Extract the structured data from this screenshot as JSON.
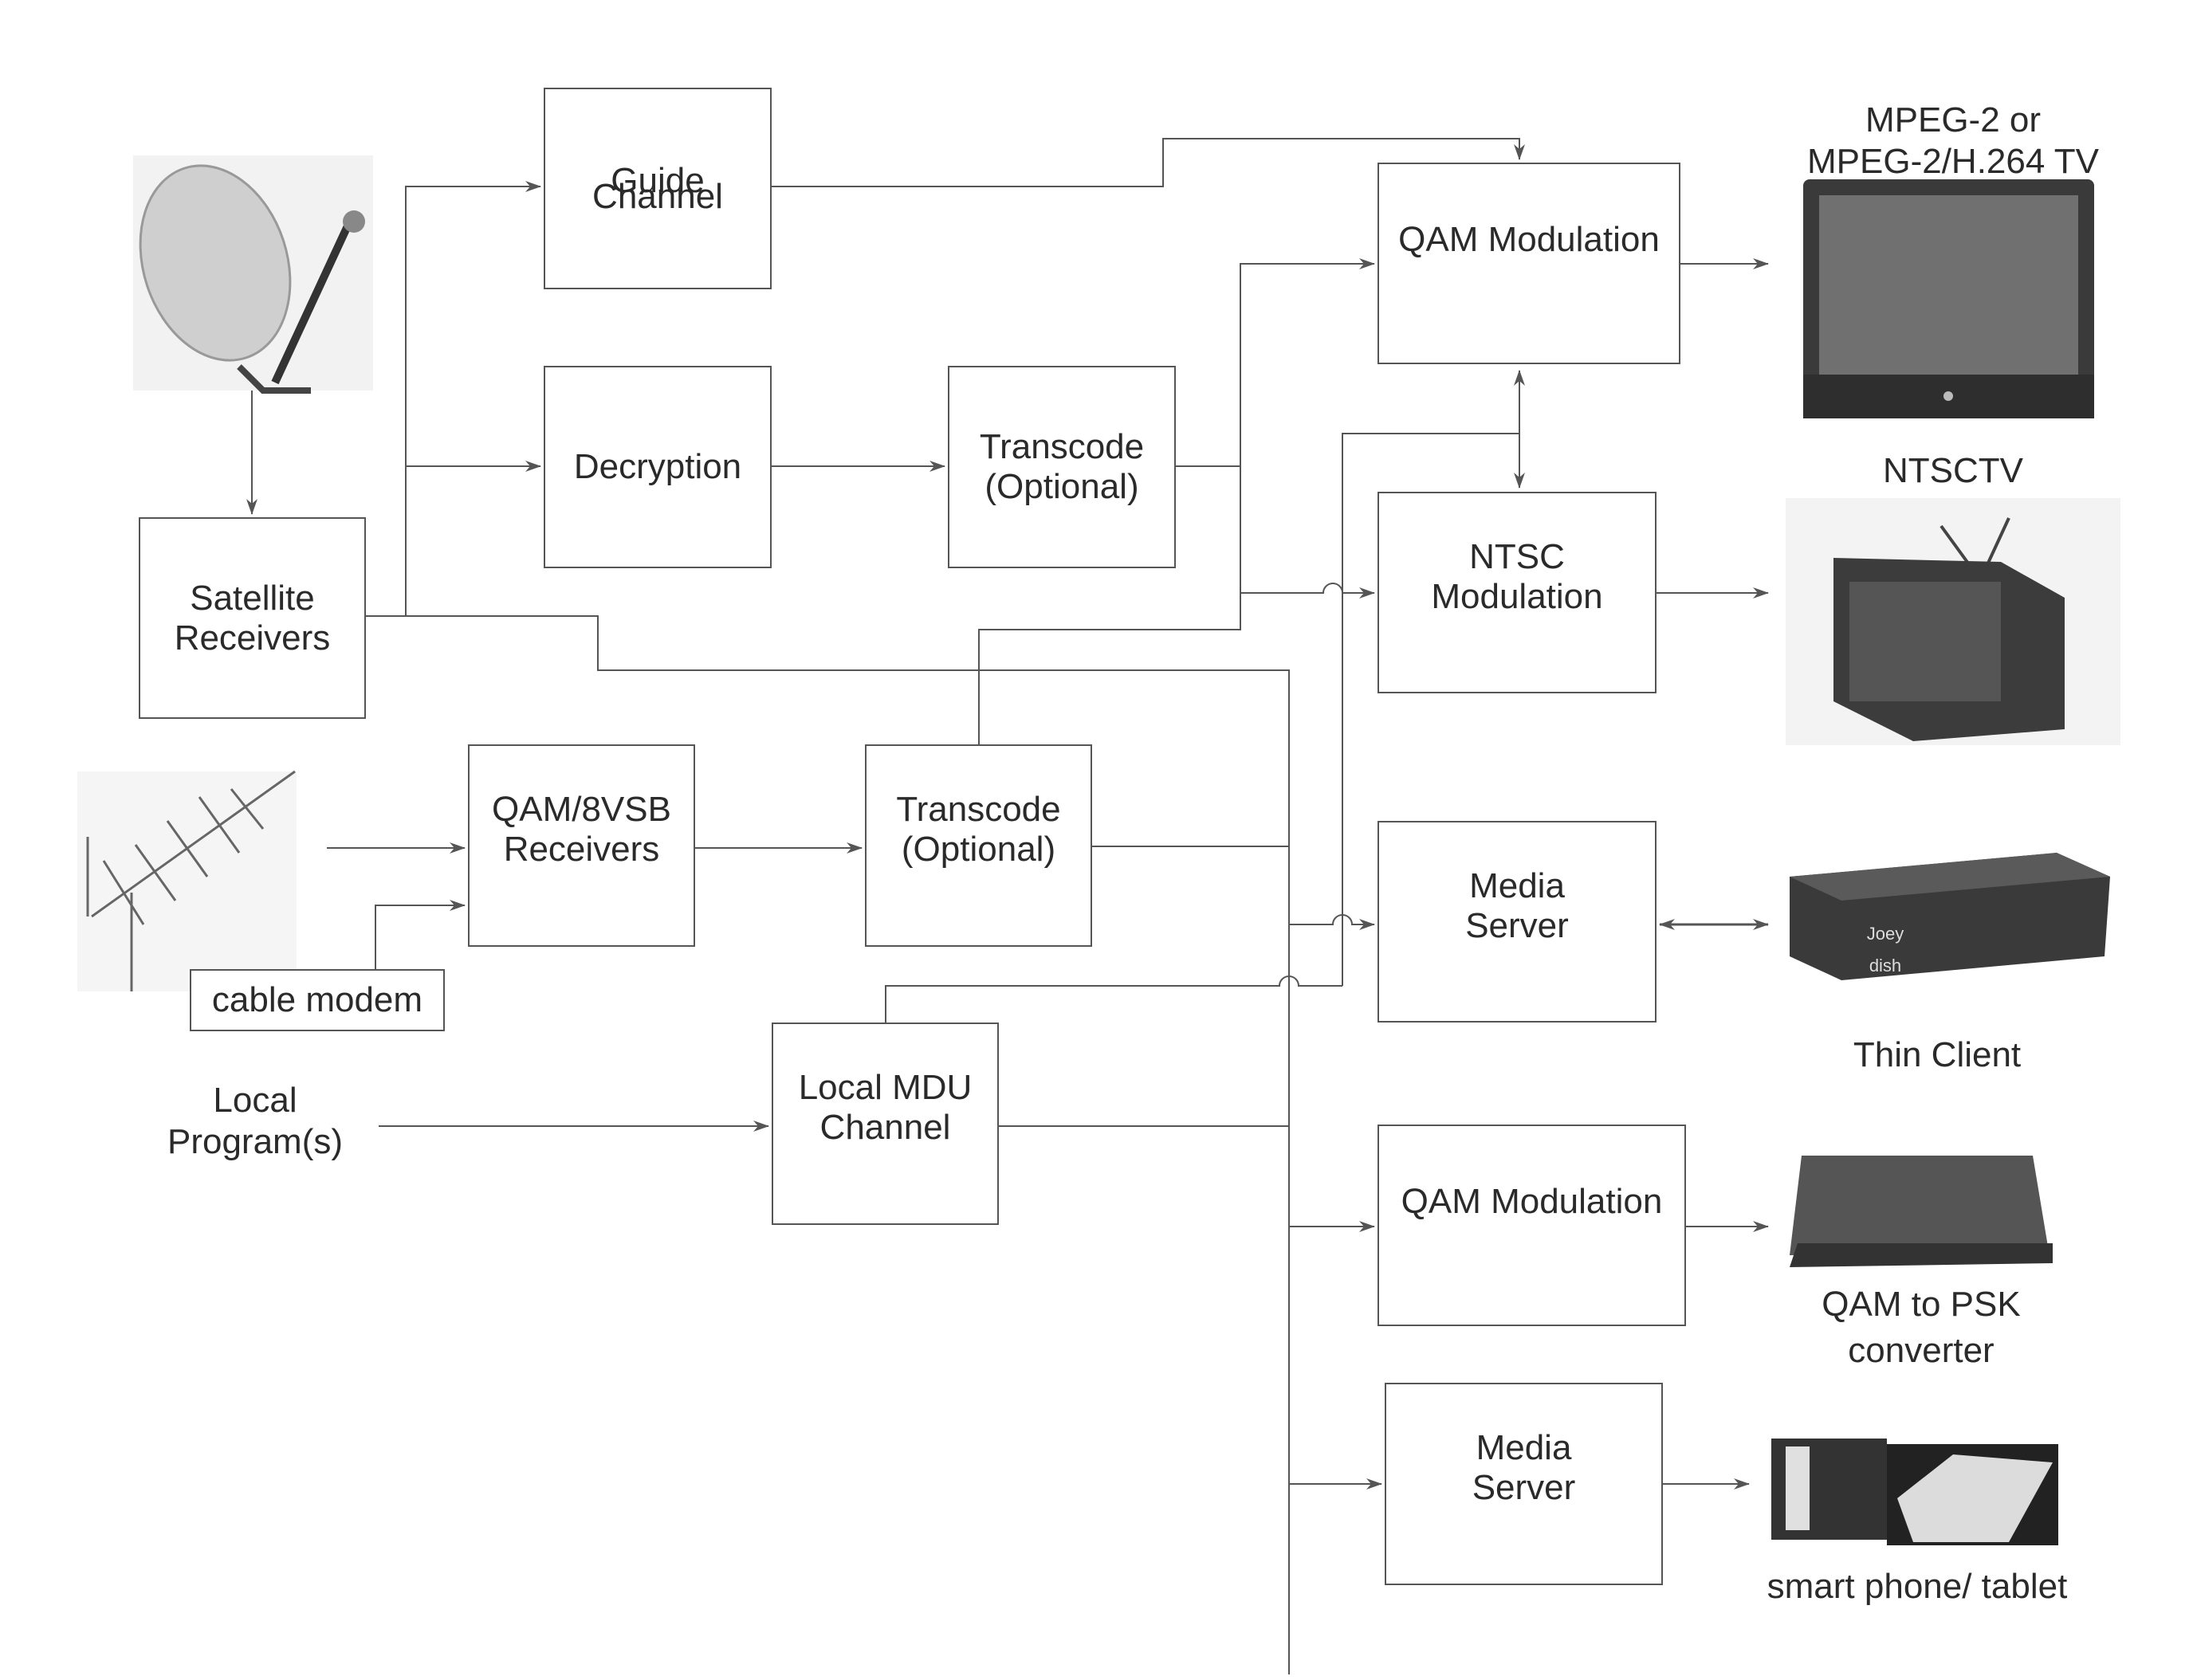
{
  "diagram": {
    "inputs": {
      "satellite_dish": "satellite-dish",
      "antenna": "terrestrial-antenna",
      "local_programs": [
        "Local",
        "Program(s)"
      ]
    },
    "boxes": {
      "satellite_receivers": [
        "Satellite",
        "Receivers"
      ],
      "guide_channel": [
        "Guide",
        "Channel"
      ],
      "decryption": [
        "Decryption"
      ],
      "transcode_1": [
        "Transcode",
        "(Optional)"
      ],
      "qam_8vsb_receivers": [
        "QAM/8VSB",
        "Receivers"
      ],
      "cable_modem": [
        "cable modem"
      ],
      "transcode_2": [
        "Transcode",
        "(Optional)"
      ],
      "local_mdu_channel": [
        "Local MDU",
        "Channel"
      ],
      "qam_modulation_1": [
        "QAM Modulation"
      ],
      "ntsc_modulation": [
        "NTSC",
        "Modulation"
      ],
      "media_server_1": [
        "Media",
        "Server"
      ],
      "qam_modulation_2": [
        "QAM Modulation"
      ],
      "media_server_2": [
        "Media",
        "Server"
      ]
    },
    "outputs": {
      "mpeg_tv": [
        "MPEG-2 or",
        "MPEG-2/H.264 TV"
      ],
      "ntsc_tv": [
        "NTSCTV"
      ],
      "thin_client": [
        "Thin Client"
      ],
      "thin_client_brand": [
        "Joey",
        "dish"
      ],
      "qam_psk": [
        "QAM to PSK",
        "converter"
      ],
      "smart_devices": [
        "smart phone/ tablet"
      ]
    },
    "colors": {
      "line": "#555555",
      "text": "#2a2a2a"
    }
  }
}
